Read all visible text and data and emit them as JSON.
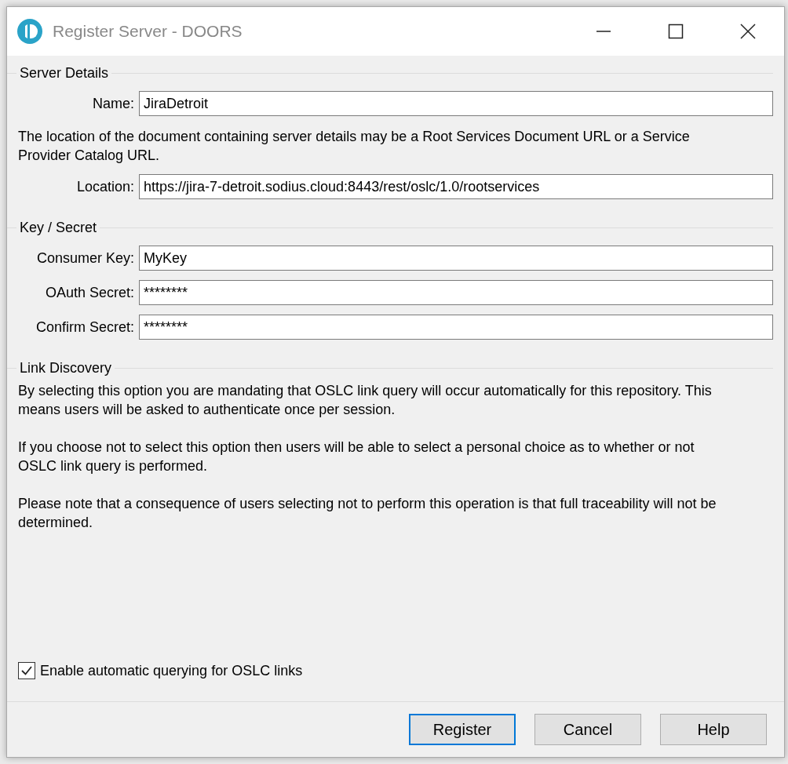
{
  "window": {
    "title": "Register Server - DOORS"
  },
  "sections": [
    {
      "title": "Server Details",
      "items": [
        {
          "kind": "field",
          "label": "Name:",
          "value": "JiraDetroit"
        },
        {
          "kind": "text",
          "text": "The location of the document containing server details may be a Root Services Document URL or a Service Provider Catalog URL."
        },
        {
          "kind": "field",
          "label": "Location:",
          "value": "https://jira-7-detroit.sodius.cloud:8443/rest/oslc/1.0/rootservices"
        }
      ]
    },
    {
      "title": "Key / Secret",
      "items": [
        {
          "kind": "field",
          "label": "Consumer Key:",
          "value": "MyKey"
        },
        {
          "kind": "field",
          "label": "OAuth Secret:",
          "value": "********"
        },
        {
          "kind": "field",
          "label": "Confirm Secret:",
          "value": "********"
        }
      ]
    },
    {
      "title": "Link Discovery",
      "items": [
        {
          "kind": "text",
          "text": "By selecting this option you are mandating that OSLC link query will occur automatically for this repository. This means users will be asked to authenticate once per session."
        },
        {
          "kind": "text",
          "text": "If you choose not to select this option then users will be able to select a personal choice as to whether or not OSLC link query is performed."
        },
        {
          "kind": "text",
          "text": "Please note that a consequence of users selecting not to perform this operation is that full traceability will not be determined."
        },
        {
          "kind": "checkbox",
          "label": "Enable automatic querying for OSLC links",
          "checked": true
        }
      ]
    }
  ],
  "buttons": [
    {
      "label": "Register",
      "default": true
    },
    {
      "label": "Cancel",
      "default": false
    },
    {
      "label": "Help",
      "default": false
    }
  ]
}
